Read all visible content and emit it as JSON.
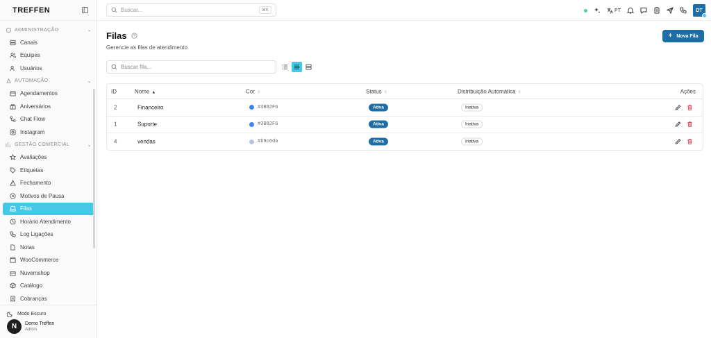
{
  "app": {
    "logo": "TREFFEN"
  },
  "colors": {
    "accent": "#45c8e6",
    "primary": "#1d6ea5"
  },
  "sidebar": {
    "sections": [
      {
        "label": "ADMINISTRAÇÃO",
        "items": [
          "Canais",
          "Equipes",
          "Usuários"
        ]
      },
      {
        "label": "AUTOMAÇÃO",
        "items": [
          "Agendamentos",
          "Aniversários",
          "Chat Flow",
          "Instagram"
        ]
      },
      {
        "label": "GESTÃO COMERCIAL",
        "items": [
          "Avaliações",
          "Etiquetas",
          "Fechamento",
          "Motivos de Pausa",
          "Filas",
          "Horário Atendimento",
          "Log Ligações",
          "Notas",
          "WooCommerce",
          "Nuvemshop",
          "Catálogo",
          "Cobranças"
        ]
      }
    ],
    "active_item": "Filas",
    "footer": {
      "mode_label": "Modo Escuro",
      "user_name": "Demo Treffen",
      "user_role": "Admin",
      "avatar_letter": "N"
    }
  },
  "topbar": {
    "search_placeholder": "Buscar...",
    "shortcut": "⌘K",
    "lang": "PT",
    "avatar": "DT"
  },
  "page": {
    "title": "Filas",
    "subtitle": "Gerencie as filas de atendimento",
    "new_button": "Nova Fila",
    "search_placeholder": "Buscar fila..."
  },
  "table": {
    "headers": {
      "id": "ID",
      "nome": "Nome",
      "cor": "Cor",
      "status": "Status",
      "dist": "Distribuição Automática",
      "acoes": "Ações"
    },
    "rows": [
      {
        "id": "2",
        "nome": "Financeiro",
        "cor": "#3B82F6",
        "status": "Ativa",
        "dist": "Inativa"
      },
      {
        "id": "1",
        "nome": "Suporte",
        "cor": "#3B82F6",
        "status": "Ativa",
        "dist": "Inativa"
      },
      {
        "id": "4",
        "nome": "vendas",
        "cor": "#b9c6da",
        "status": "Ativa",
        "dist": "Inativa"
      }
    ]
  }
}
